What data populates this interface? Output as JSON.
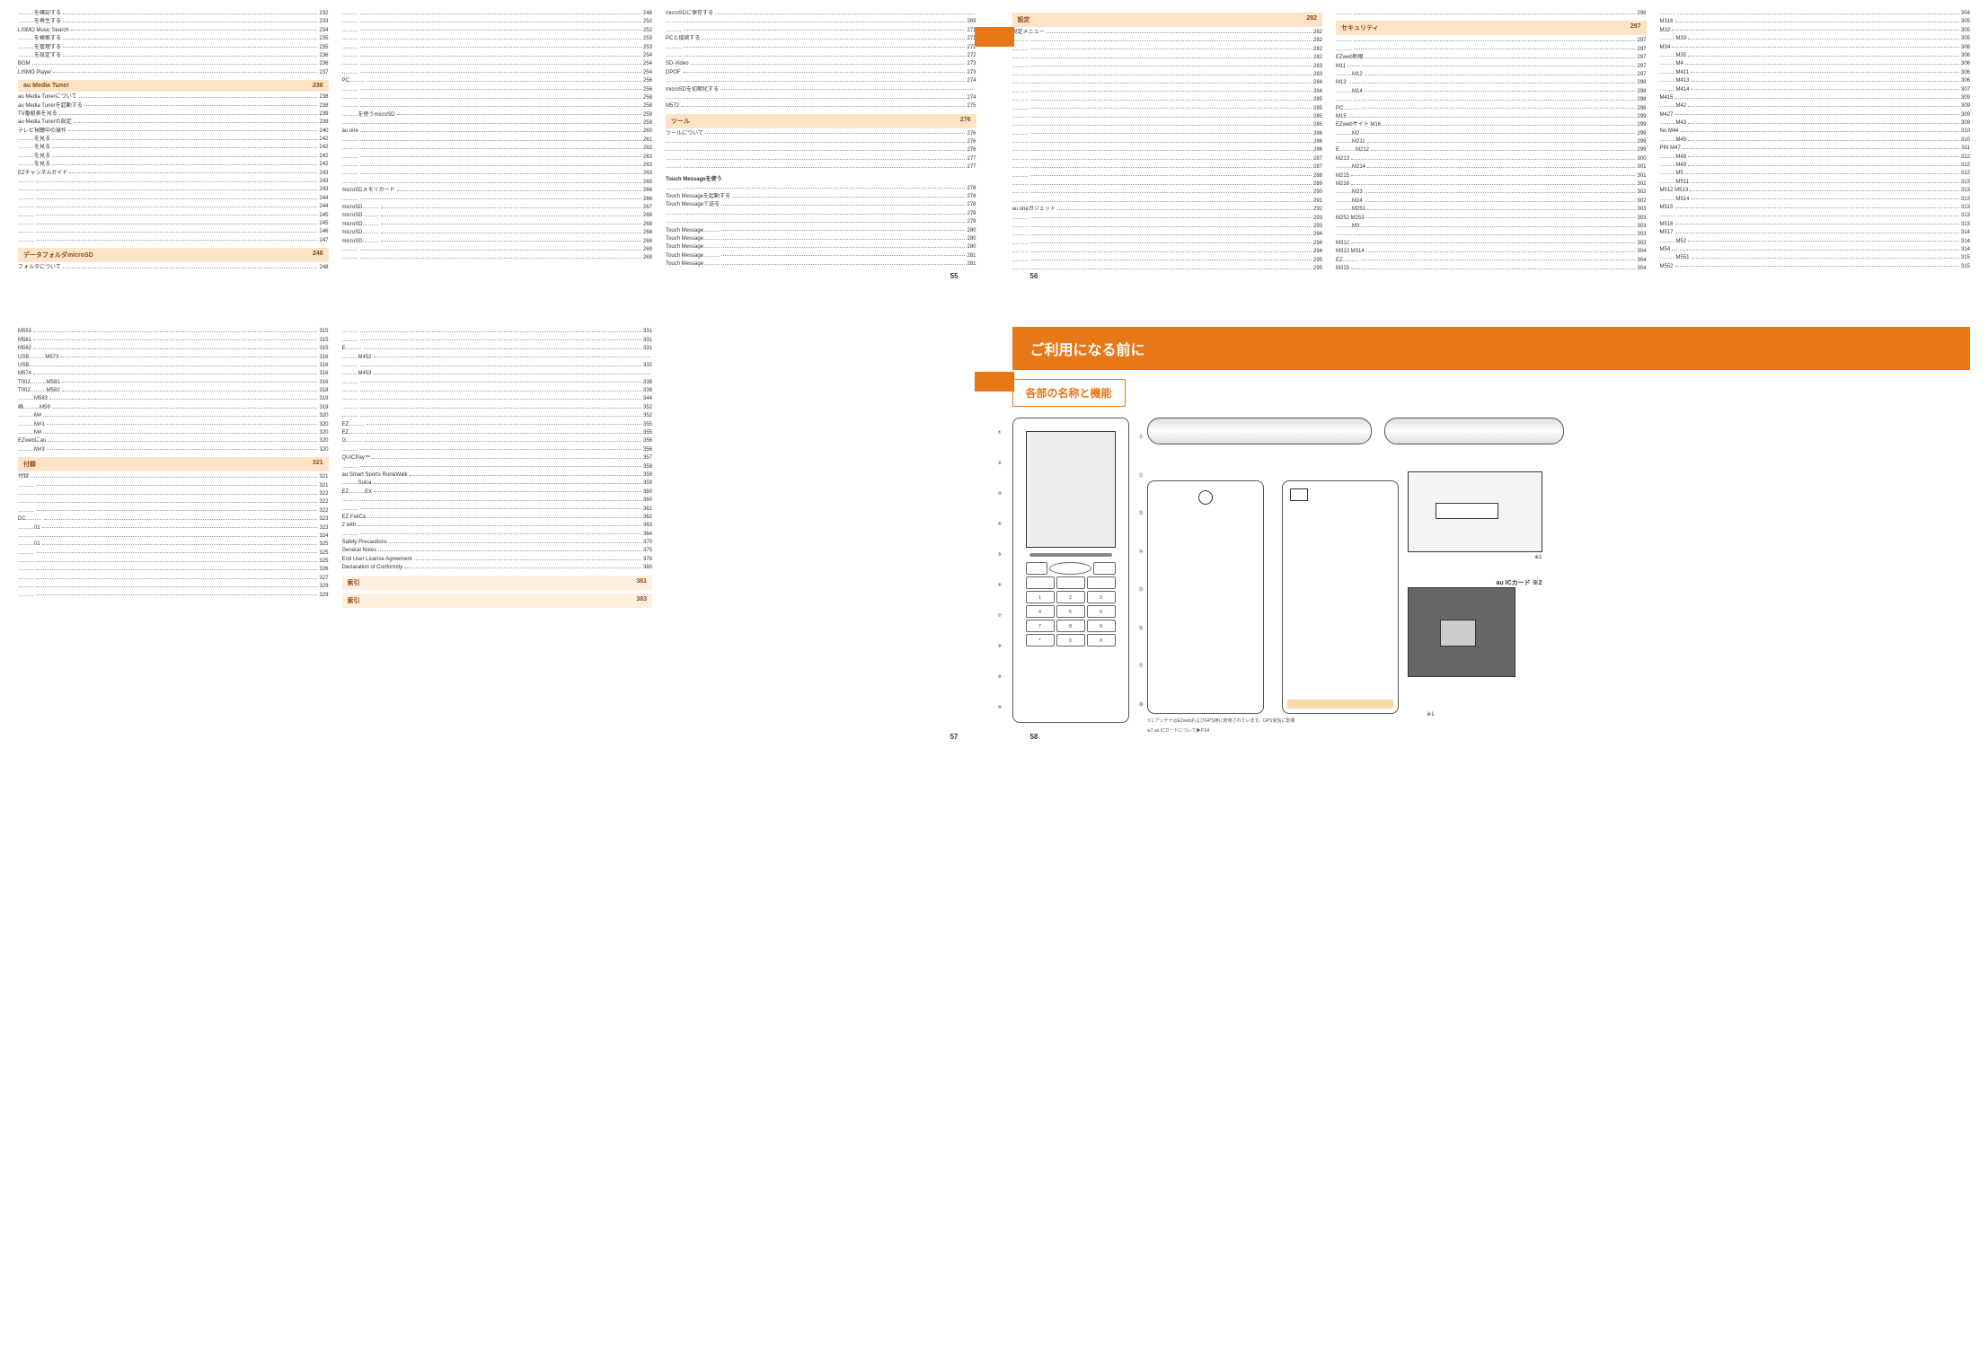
{
  "page_numbers": {
    "p55": "55",
    "p56": "56",
    "p57": "57",
    "p58": "58"
  },
  "toc55_col1": {
    "top_items": [
      {
        "label": "………を確認する",
        "pg": "232"
      },
      {
        "label": "………を再生する",
        "pg": "233"
      },
      {
        "label": "LISMO Music Search",
        "pg": "234"
      },
      {
        "label": "………を検索する",
        "pg": "235"
      },
      {
        "label": "………を管理する",
        "pg": "235"
      },
      {
        "label": "………を設定する",
        "pg": "236"
      },
      {
        "label": "BGM",
        "pg": "236"
      },
      {
        "label": "LISMO Player",
        "pg": "237"
      }
    ],
    "header1": {
      "title": "au Media Tuner",
      "pg": "238"
    },
    "items1": [
      {
        "label": "au Media Tunerについて",
        "pg": "238"
      },
      {
        "label": "au Media Tunerを起動する",
        "pg": "238"
      },
      {
        "label": "TV番組表を見る",
        "pg": "239"
      },
      {
        "label": "au Media Tunerの設定",
        "pg": "239"
      },
      {
        "label": "テレビ視聴中の操作",
        "pg": "240"
      },
      {
        "label": "………を見る",
        "pg": "242"
      },
      {
        "label": "………を見る",
        "pg": "242"
      },
      {
        "label": "………を見る",
        "pg": "242"
      },
      {
        "label": "………を見る",
        "pg": "242"
      },
      {
        "label": "EZチャンネルガイド",
        "pg": "243"
      },
      {
        "label": "………",
        "pg": "243"
      },
      {
        "label": "………",
        "pg": "243"
      },
      {
        "label": "………",
        "pg": "244"
      },
      {
        "label": "………",
        "pg": "244"
      },
      {
        "label": "………",
        "pg": "245"
      },
      {
        "label": "………",
        "pg": "245"
      },
      {
        "label": "………",
        "pg": "246"
      },
      {
        "label": "………",
        "pg": "247"
      }
    ],
    "header2": {
      "title": "データフォルダmicroSD",
      "pg": "248"
    },
    "items2": [
      {
        "label": "フォルダについて",
        "pg": "248"
      }
    ]
  },
  "toc55_col2": [
    {
      "label": "………",
      "pg": "248"
    },
    {
      "label": "………",
      "pg": "252"
    },
    {
      "label": "………",
      "pg": "252"
    },
    {
      "label": "………",
      "pg": "253"
    },
    {
      "label": "………",
      "pg": "253"
    },
    {
      "label": "………",
      "pg": "254"
    },
    {
      "label": "………",
      "pg": "254"
    },
    {
      "label": "………",
      "pg": "254"
    },
    {
      "label": "PC………",
      "pg": "256"
    },
    {
      "label": "………",
      "pg": "256"
    },
    {
      "label": "………",
      "pg": "258"
    },
    {
      "label": "………",
      "pg": "258"
    },
    {
      "label": "………を使うmicroSD",
      "pg": "259"
    },
    {
      "label": "………",
      "pg": "259"
    },
    {
      "label": "au one",
      "pg": "260"
    },
    {
      "label": "………",
      "pg": "261"
    },
    {
      "label": "………",
      "pg": "262"
    },
    {
      "label": "………",
      "pg": "263"
    },
    {
      "label": "………",
      "pg": "263"
    },
    {
      "label": "………",
      "pg": "263"
    },
    {
      "label": "………",
      "pg": "265"
    },
    {
      "label": "microSDメモリカード",
      "pg": "266"
    },
    {
      "label": "………",
      "pg": "266"
    },
    {
      "label": "microSD………",
      "pg": "267"
    },
    {
      "label": "microSD………",
      "pg": "268"
    },
    {
      "label": "microSD………",
      "pg": "268"
    },
    {
      "label": "microSD………",
      "pg": "268"
    },
    {
      "label": "microSD………",
      "pg": "268"
    },
    {
      "label": "………",
      "pg": "269"
    },
    {
      "label": "………",
      "pg": "269"
    }
  ],
  "toc55_col3": {
    "top": [
      {
        "label": "microSDに保存する",
        "pg": ""
      },
      {
        "label": "………",
        "pg": "269"
      },
      {
        "label": "………",
        "pg": "271"
      },
      {
        "label": "PCと接続する",
        "pg": "271"
      },
      {
        "label": "………",
        "pg": "272"
      },
      {
        "label": "………",
        "pg": "272"
      },
      {
        "label": "SD-Video",
        "pg": "273"
      },
      {
        "label": "DPOF",
        "pg": "273"
      },
      {
        "label": "………",
        "pg": "274"
      },
      {
        "label": "microSDを初期化する",
        "pg": ""
      },
      {
        "label": "………",
        "pg": "274"
      },
      {
        "label": "M572",
        "pg": "275"
      }
    ],
    "header1": {
      "title": "ツール",
      "pg": "276"
    },
    "items1": [
      {
        "label": "ツールについて",
        "pg": "276"
      },
      {
        "label": "………",
        "pg": "276"
      },
      {
        "label": "………",
        "pg": "276"
      },
      {
        "label": "………",
        "pg": "277"
      },
      {
        "label": "………",
        "pg": "277"
      }
    ],
    "tm_label": "Touch Messageを使う",
    "tm_items": [
      {
        "label": "………",
        "pg": "278"
      },
      {
        "label": "Touch Messageを起動する",
        "pg": "278"
      },
      {
        "label": "Touch Messageで送る",
        "pg": "278"
      },
      {
        "label": "………",
        "pg": "279"
      },
      {
        "label": "………",
        "pg": "279"
      },
      {
        "label": "Touch Message………",
        "pg": "280"
      },
      {
        "label": "Touch Message………",
        "pg": "280"
      },
      {
        "label": "Touch Message………",
        "pg": "280"
      },
      {
        "label": "Touch Message………",
        "pg": "281"
      },
      {
        "label": "Touch Message………",
        "pg": "281"
      }
    ]
  },
  "toc56_col1": {
    "header": {
      "title": "設定",
      "pg": "282"
    },
    "items": [
      {
        "label": "設定メニュー",
        "pg": "282"
      },
      {
        "label": "………",
        "pg": "282"
      },
      {
        "label": "………",
        "pg": "282"
      },
      {
        "label": "………",
        "pg": "282"
      },
      {
        "label": "………",
        "pg": "283"
      },
      {
        "label": "………",
        "pg": "283"
      },
      {
        "label": "………",
        "pg": "284"
      },
      {
        "label": "………",
        "pg": "284"
      },
      {
        "label": "………",
        "pg": "285"
      },
      {
        "label": "………",
        "pg": "285"
      },
      {
        "label": "………",
        "pg": "285"
      },
      {
        "label": "………",
        "pg": "285"
      },
      {
        "label": "………",
        "pg": "286"
      },
      {
        "label": "………",
        "pg": "286"
      },
      {
        "label": "………",
        "pg": "286"
      },
      {
        "label": "………",
        "pg": "287"
      },
      {
        "label": "………",
        "pg": "287"
      },
      {
        "label": "………",
        "pg": "288"
      },
      {
        "label": "………",
        "pg": "289"
      },
      {
        "label": "………",
        "pg": "290"
      },
      {
        "label": "………",
        "pg": "291"
      },
      {
        "label": "au oneガジェット",
        "pg": "292"
      },
      {
        "label": "………",
        "pg": "293"
      },
      {
        "label": "………",
        "pg": "293"
      },
      {
        "label": "………",
        "pg": "294"
      },
      {
        "label": "………",
        "pg": "294"
      },
      {
        "label": "………",
        "pg": "294"
      },
      {
        "label": "………",
        "pg": "295"
      },
      {
        "label": "………",
        "pg": "295"
      }
    ]
  },
  "toc56_col2": {
    "top": [
      {
        "label": "………",
        "pg": "296"
      }
    ],
    "header": {
      "title": "セキュリティ",
      "pg": "297"
    },
    "items": [
      {
        "label": "………",
        "pg": "297"
      },
      {
        "label": "………",
        "pg": "297"
      },
      {
        "label": "EZweb制限",
        "pg": "297"
      },
      {
        "label": "M11",
        "pg": "297"
      },
      {
        "label": "………M12",
        "pg": "297"
      },
      {
        "label": "M13",
        "pg": "298"
      },
      {
        "label": "………M14",
        "pg": "298"
      },
      {
        "label": "………",
        "pg": "298"
      },
      {
        "label": "PC………",
        "pg": "298"
      },
      {
        "label": "M15",
        "pg": "299"
      },
      {
        "label": "EZwebサイト M16",
        "pg": "299"
      },
      {
        "label": "………M2",
        "pg": "299"
      },
      {
        "label": "………M211",
        "pg": "299"
      },
      {
        "label": "E………M212",
        "pg": "299"
      },
      {
        "label": "M213",
        "pg": "300"
      },
      {
        "label": "………M214",
        "pg": "301"
      },
      {
        "label": "M215",
        "pg": "301"
      },
      {
        "label": "M216",
        "pg": "302"
      },
      {
        "label": "………M23",
        "pg": "302"
      },
      {
        "label": "………M24",
        "pg": "302"
      },
      {
        "label": "………M251",
        "pg": "303"
      },
      {
        "label": "M252 M253",
        "pg": "303"
      },
      {
        "label": "………M3",
        "pg": "303"
      },
      {
        "label": "………",
        "pg": "303"
      },
      {
        "label": "M312",
        "pg": "303"
      },
      {
        "label": "M313 M314",
        "pg": "304"
      },
      {
        "label": "EZ………",
        "pg": "304"
      },
      {
        "label": "M315",
        "pg": "304"
      }
    ]
  },
  "toc56_col3": [
    {
      "label": "………",
      "pg": "304"
    },
    {
      "label": "M316",
      "pg": "305"
    },
    {
      "label": "M32",
      "pg": "305"
    },
    {
      "label": "………M33",
      "pg": "305"
    },
    {
      "label": "M34",
      "pg": "306"
    },
    {
      "label": "………M35",
      "pg": "306"
    },
    {
      "label": "………M4",
      "pg": "306"
    },
    {
      "label": "………M411",
      "pg": "306"
    },
    {
      "label": "………M413",
      "pg": "306"
    },
    {
      "label": "………M414",
      "pg": "307"
    },
    {
      "label": "M415",
      "pg": "309"
    },
    {
      "label": "………M42",
      "pg": "309"
    },
    {
      "label": "M427",
      "pg": "309"
    },
    {
      "label": "………M43",
      "pg": "309"
    },
    {
      "label": "No M44",
      "pg": "310"
    },
    {
      "label": "………M45",
      "pg": "310"
    },
    {
      "label": "PIN M47",
      "pg": "311"
    },
    {
      "label": "………M48",
      "pg": "312"
    },
    {
      "label": "………M49",
      "pg": "312"
    },
    {
      "label": "………M5",
      "pg": "312"
    },
    {
      "label": "………M511",
      "pg": "313"
    },
    {
      "label": "M512 M513",
      "pg": "313"
    },
    {
      "label": "………M514",
      "pg": "313"
    },
    {
      "label": "M515",
      "pg": "313"
    },
    {
      "label": "………",
      "pg": "313"
    },
    {
      "label": "M516",
      "pg": "313"
    },
    {
      "label": "M517",
      "pg": "314"
    },
    {
      "label": "………M52",
      "pg": "314"
    },
    {
      "label": "M54",
      "pg": "314"
    },
    {
      "label": "………M551",
      "pg": "315"
    },
    {
      "label": "M552",
      "pg": "315"
    }
  ],
  "toc57_col1": {
    "top": [
      {
        "label": "M553",
        "pg": "315"
      },
      {
        "label": "M561",
        "pg": "315"
      },
      {
        "label": "M562",
        "pg": "315"
      },
      {
        "label": "USB………M573",
        "pg": "316"
      },
      {
        "label": "USB………",
        "pg": "316"
      },
      {
        "label": "M574",
        "pg": "316"
      },
      {
        "label": "T002………M581",
        "pg": "316"
      },
      {
        "label": "T002………M582",
        "pg": "318"
      },
      {
        "label": "………M583",
        "pg": "319"
      },
      {
        "label": "画………M59",
        "pg": "319"
      },
      {
        "label": "………M#",
        "pg": "320"
      },
      {
        "label": "………M#1",
        "pg": "320"
      },
      {
        "label": "………M#",
        "pg": "320"
      },
      {
        "label": "EZwebにau",
        "pg": "320"
      },
      {
        "label": "………M#3",
        "pg": "320"
      }
    ],
    "header1": {
      "title": "付録",
      "pg": "321"
    },
    "items1": [
      {
        "label": "付録",
        "pg": "321"
      },
      {
        "label": "………",
        "pg": "321"
      },
      {
        "label": "………",
        "pg": "322"
      },
      {
        "label": "………",
        "pg": "322"
      },
      {
        "label": "………",
        "pg": "322"
      },
      {
        "label": "DC………",
        "pg": "323"
      },
      {
        "label": "………01",
        "pg": "323"
      },
      {
        "label": "………",
        "pg": "324"
      },
      {
        "label": "………01",
        "pg": "325"
      },
      {
        "label": "………",
        "pg": "325"
      },
      {
        "label": "………",
        "pg": "325"
      },
      {
        "label": "………",
        "pg": "326"
      },
      {
        "label": "………",
        "pg": "327"
      },
      {
        "label": "………",
        "pg": "329"
      },
      {
        "label": "………",
        "pg": "329"
      }
    ]
  },
  "toc57_col2": {
    "top": [
      {
        "label": "………",
        "pg": "331"
      },
      {
        "label": "………",
        "pg": "331"
      },
      {
        "label": "E………",
        "pg": "331"
      },
      {
        "label": "………M452",
        "pg": ""
      },
      {
        "label": "………",
        "pg": "332"
      },
      {
        "label": "………M453",
        "pg": ""
      },
      {
        "label": "………",
        "pg": "338"
      },
      {
        "label": "………",
        "pg": "339"
      },
      {
        "label": "………",
        "pg": "344"
      },
      {
        "label": "………",
        "pg": "352"
      },
      {
        "label": "………",
        "pg": "352"
      },
      {
        "label": "EZ………",
        "pg": "355"
      },
      {
        "label": "EZ………",
        "pg": "355"
      },
      {
        "label": "G………",
        "pg": "356"
      },
      {
        "label": "………",
        "pg": "356"
      },
      {
        "label": "QUICPay™",
        "pg": "357"
      },
      {
        "label": "………",
        "pg": "358"
      },
      {
        "label": "au Smart Sports Run&Walk",
        "pg": "359"
      },
      {
        "label": "………Suica",
        "pg": "359"
      },
      {
        "label": "EZ………EX",
        "pg": "360"
      },
      {
        "label": "………",
        "pg": "360"
      },
      {
        "label": "………",
        "pg": "361"
      },
      {
        "label": "EZ FeliCa",
        "pg": "362"
      },
      {
        "label": "2 with",
        "pg": "363"
      },
      {
        "label": "………",
        "pg": "364"
      },
      {
        "label": "Safety Precautions",
        "pg": "370"
      },
      {
        "label": "General Notes",
        "pg": "375"
      },
      {
        "label": "End User License Agreement",
        "pg": "378"
      },
      {
        "label": "Declaration of Conformity",
        "pg": "380"
      }
    ],
    "header1": {
      "title": "索引",
      "pg": "381"
    },
    "header2": {
      "title": "索引",
      "pg": "383"
    }
  },
  "chapter": {
    "title": "ご利用になる前に",
    "sub": "各部の名称と機能",
    "label_auic": "au ICカード",
    "fn1": "※1 アンテナはEZwebおよびGPS用に使用されています。GPS受信に影響",
    "fn2": "※2 au ICカードについて▶P.64",
    "markers_left": [
      "①",
      "②",
      "③",
      "④",
      "⑤",
      "⑥",
      "⑦",
      "⑧",
      "⑨",
      "⑩"
    ],
    "markers_right": [
      "⑪",
      "⑫",
      "⑬",
      "⑭",
      "⑮",
      "⑯",
      "⑰",
      "⑱"
    ],
    "star1": "※1",
    "star2": "※2"
  }
}
